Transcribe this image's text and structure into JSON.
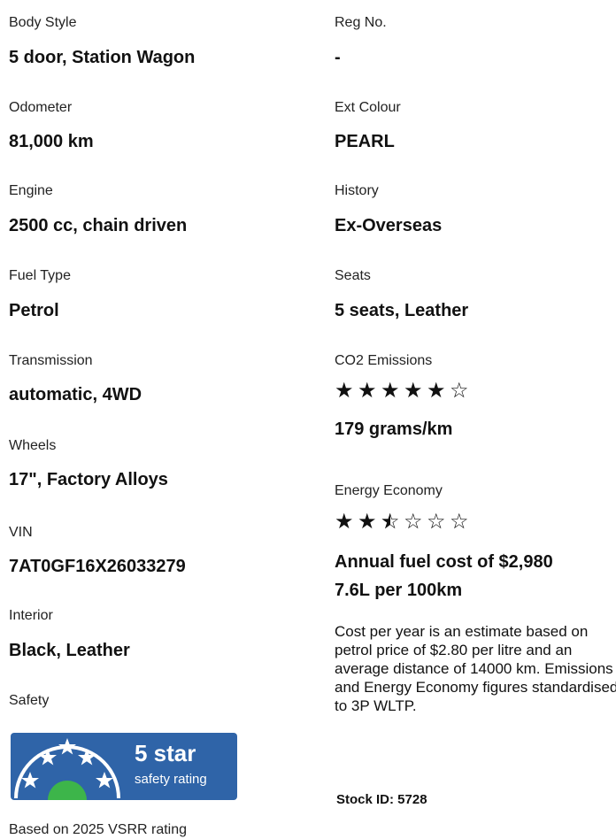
{
  "left": [
    {
      "label": "Body Style",
      "value": "5 door, Station Wagon"
    },
    {
      "label": "Odometer",
      "value": "81,000 km"
    },
    {
      "label": "Engine",
      "value": "2500 cc, chain driven"
    },
    {
      "label": "Fuel Type",
      "value": "Petrol"
    },
    {
      "label": "Transmission",
      "value": "automatic, 4WD"
    },
    {
      "label": "Wheels",
      "value": "17\", Factory Alloys"
    },
    {
      "label": "VIN",
      "value": "7AT0GF16X26033279"
    },
    {
      "label": "Interior",
      "value": "Black, Leather"
    }
  ],
  "safety": {
    "label": "Safety",
    "badge_number": "5 star",
    "badge_subtitle": "safety rating",
    "rating_stars": 5,
    "note": "Based on 2025 VSRR rating",
    "badge_color": "#2f64a8"
  },
  "right": [
    {
      "label": "Reg No.",
      "value": "-"
    },
    {
      "label": "Ext Colour",
      "value": "PEARL"
    },
    {
      "label": "History",
      "value": "Ex-Overseas"
    },
    {
      "label": "Seats",
      "value": "5 seats, Leather"
    }
  ],
  "co2": {
    "label": "CO2 Emissions",
    "rating": 5,
    "max": 6,
    "value": "179 grams/km"
  },
  "energy": {
    "label": "Energy Economy",
    "rating": 2.5,
    "max": 6,
    "annual_cost": "Annual fuel cost of $2,980",
    "consumption": "7.6L per 100km",
    "note": "Cost per year is an estimate based on petrol price of  $2.80 per litre and an average distance of 14000 km. Emissions and Energy Economy figures standardised to 3P WLTP."
  },
  "stock": {
    "text": "Stock ID: 5728"
  }
}
